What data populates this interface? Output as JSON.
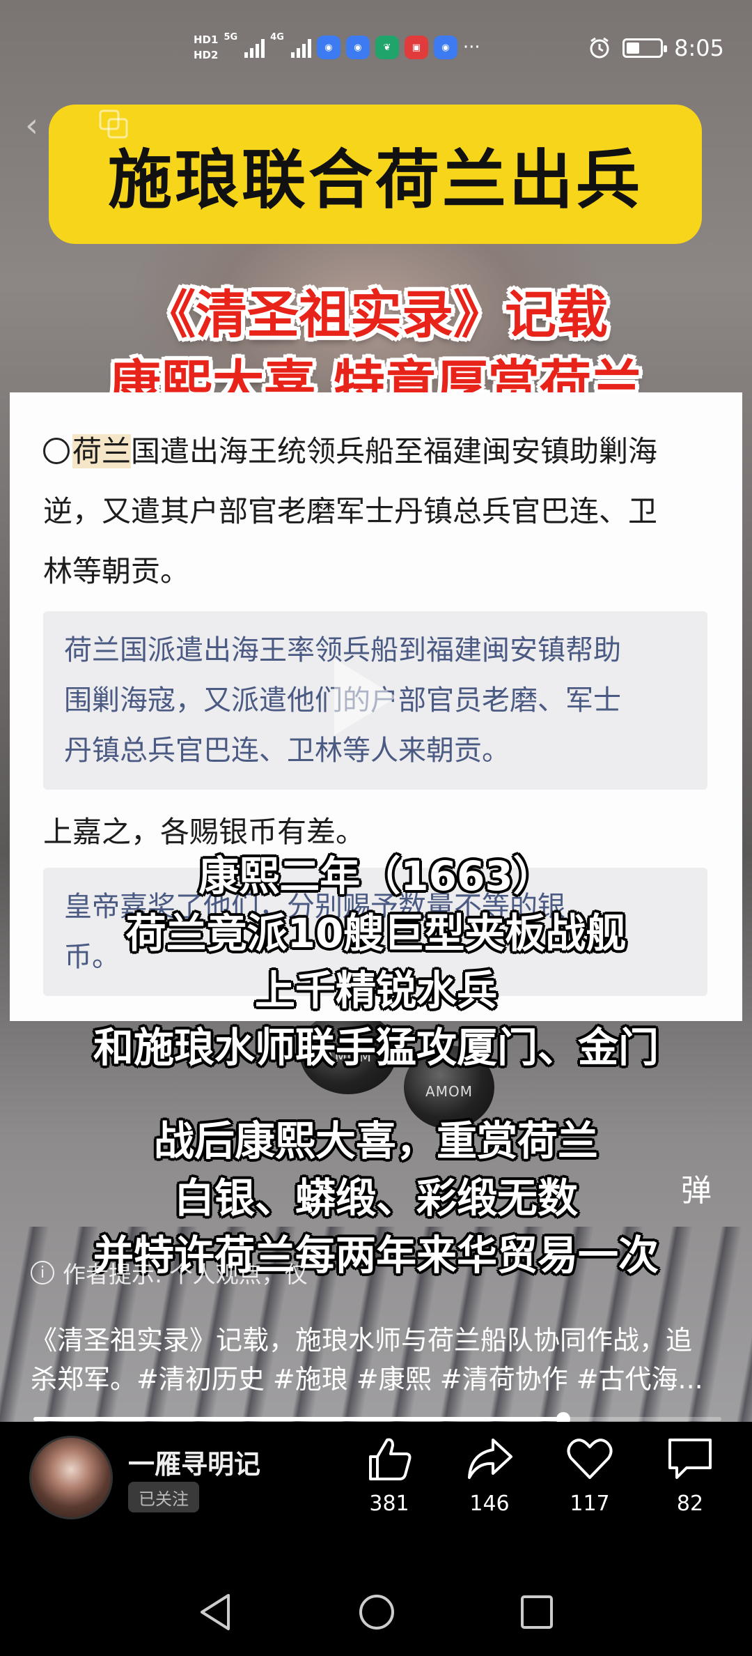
{
  "status_bar": {
    "hd1": "HD1",
    "hd2": "HD2",
    "net1": "5G",
    "net2": "4G",
    "dots": "···",
    "time": "8:05"
  },
  "banner": {
    "title": "施琅联合荷兰出兵"
  },
  "red_title": {
    "line1": "《清圣祖实录》记载",
    "line2": "康熙大喜  特意厚赏荷兰"
  },
  "document": {
    "p1_highlight": "荷兰",
    "p1_lines": [
      "国遣出海王统领兵船至福建闽安镇助剿海",
      "逆，又遣其户部官老磨军士丹镇总兵官巴连、卫",
      "林等朝贡。"
    ],
    "p1_trans": [
      "荷兰国派遣出海王率领兵船到福建闽安镇帮助",
      "围剿海寇，又派遣他们的户部官员老磨、军士",
      "丹镇总兵官巴连、卫林等人来朝贡。"
    ],
    "p2": "上嘉之，各赐银币有差。",
    "p2_trans": [
      "皇帝嘉奖了他们，分别赐予数量不等的银",
      "币。"
    ]
  },
  "subtitles": {
    "lines": [
      "康熙二年（1663）",
      "荷兰竟派10艘巨型夹板战舰",
      "上千精锐水兵",
      "和施琅水师联手猛攻厦门、金门",
      "战后康熙大喜，重赏荷兰",
      "白银、蟒缎、彩缎无数",
      "并特许荷兰每两年来华贸易一次"
    ]
  },
  "earbud_label": "AMOM",
  "danmu_label": "弹",
  "author_tip": "作者提示: 个人观点，仅",
  "description": {
    "line1": "《清圣祖实录》记载，施琅水师与荷兰船队协同作战，追",
    "line2": "杀郑军。#清初历史 #施琅 #康熙 #清荷协作 #古代海..."
  },
  "progress": {
    "fraction": 0.77
  },
  "channel": {
    "name": "一雁寻明记",
    "follow_label": "已关注"
  },
  "actions": {
    "like": "381",
    "share": "146",
    "favorite": "117",
    "comment": "82"
  },
  "icons": [
    "back-icon",
    "copy-icon",
    "play-icon",
    "info-icon",
    "like-icon",
    "share-icon",
    "heart-icon",
    "comment-icon",
    "nav-back-icon",
    "nav-home-icon",
    "nav-recents-icon",
    "alarm-icon",
    "battery-icon"
  ]
}
